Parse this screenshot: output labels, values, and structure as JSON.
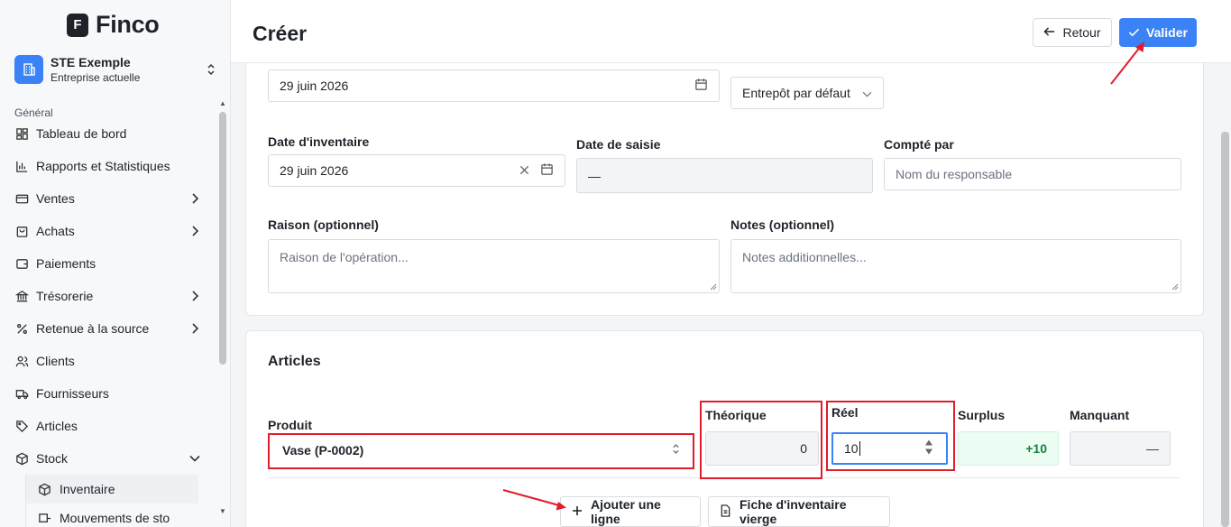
{
  "app": {
    "logo_letter": "F",
    "logo_text": "Finco"
  },
  "company": {
    "name": "STE Exemple",
    "subtitle": "Entreprise actuelle"
  },
  "sidebar": {
    "section_label": "Général",
    "items": [
      {
        "label": "Tableau de bord",
        "icon": "dashboard-icon",
        "chevron": false
      },
      {
        "label": "Rapports et Statistiques",
        "icon": "bar-chart-icon",
        "chevron": false
      },
      {
        "label": "Ventes",
        "icon": "credit-card-icon",
        "chevron": "right"
      },
      {
        "label": "Achats",
        "icon": "shopping-bag-icon",
        "chevron": "right"
      },
      {
        "label": "Paiements",
        "icon": "wallet-icon",
        "chevron": false
      },
      {
        "label": "Trésorerie",
        "icon": "bank-icon",
        "chevron": "right"
      },
      {
        "label": "Retenue à la source",
        "icon": "percent-icon",
        "chevron": "right"
      },
      {
        "label": "Clients",
        "icon": "users-icon",
        "chevron": false
      },
      {
        "label": "Fournisseurs",
        "icon": "truck-icon",
        "chevron": false
      },
      {
        "label": "Articles",
        "icon": "tag-icon",
        "chevron": false
      },
      {
        "label": "Stock",
        "icon": "box-icon",
        "chevron": "down"
      }
    ],
    "sub_items": [
      {
        "label": "Inventaire",
        "icon": "cube-icon"
      },
      {
        "label": "Mouvements de sto",
        "icon": "move-icon"
      }
    ]
  },
  "header": {
    "title": "Créer",
    "back_label": "Retour",
    "validate_label": "Valider"
  },
  "form": {
    "date_value": "29 juin 2026",
    "warehouse_value": "Entrepôt par défaut",
    "inventory_date_label": "Date d'inventaire",
    "inventory_date_value": "29 juin 2026",
    "entry_date_label": "Date de saisie",
    "entry_date_value": "—",
    "counted_by_label": "Compté par",
    "counted_by_placeholder": "Nom du responsable",
    "reason_label": "Raison (optionnel)",
    "reason_placeholder": "Raison de l'opération...",
    "notes_label": "Notes (optionnel)",
    "notes_placeholder": "Notes additionnelles..."
  },
  "articles": {
    "title": "Articles",
    "col_product": "Produit",
    "col_theoretical": "Théorique",
    "col_real": "Réel",
    "col_surplus": "Surplus",
    "col_missing": "Manquant",
    "row": {
      "product": "Vase (P-0002)",
      "theoretical": "0",
      "real": "10",
      "surplus": "+10",
      "missing": "—"
    },
    "add_line_label": "Ajouter une ligne",
    "blank_sheet_label": "Fiche d'inventaire vierge"
  },
  "colors": {
    "accent": "#3b82f6",
    "highlight": "#e11d2a",
    "surplus_bg": "#ecfdf3",
    "surplus_text": "#15803d"
  }
}
